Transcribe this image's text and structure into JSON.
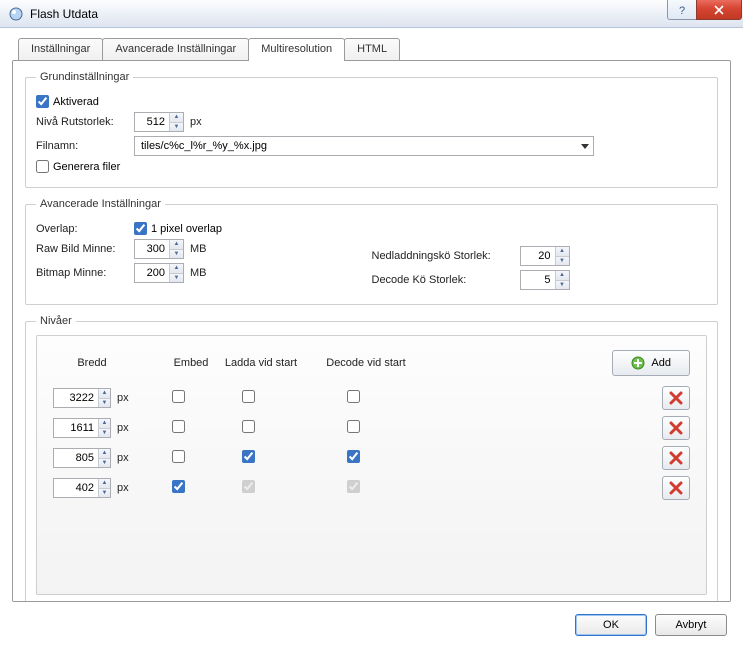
{
  "window": {
    "title": "Flash Utdata"
  },
  "tabs": {
    "settings": "Inställningar",
    "advanced": "Avancerade Inställningar",
    "multires": "Multiresolution",
    "html": "HTML",
    "active": "multires"
  },
  "basic": {
    "legend": "Grundinställningar",
    "enabled_label": "Aktiverad",
    "enabled": true,
    "gridsize_label": "Nivå Rutstorlek:",
    "gridsize": "512",
    "gridsize_unit": "px",
    "filename_label": "Filnamn:",
    "filename": "tiles/c%c_l%r_%y_%x.jpg",
    "generate_label": "Generera filer",
    "generate": false
  },
  "adv": {
    "legend": "Avancerade Inställningar",
    "overlap_label": "Overlap:",
    "overlap_check_label": "1 pixel overlap",
    "overlap": true,
    "raw_label": "Raw Bild Minne:",
    "raw_value": "300",
    "raw_unit": "MB",
    "bitmap_label": "Bitmap Minne:",
    "bitmap_value": "200",
    "bitmap_unit": "MB",
    "download_label": "Nedladdningskö Storlek:",
    "download_value": "20",
    "decode_label": "Decode Kö Storlek:",
    "decode_value": "5"
  },
  "levels": {
    "legend": "Nivåer",
    "head_width": "Bredd",
    "head_embed": "Embed",
    "head_load": "Ladda vid start",
    "head_decode": "Decode vid start",
    "add_label": "Add",
    "unit": "px",
    "rows": [
      {
        "width": "3222",
        "embed": false,
        "load": false,
        "decode": false,
        "load_disabled": false,
        "decode_disabled": false
      },
      {
        "width": "1611",
        "embed": false,
        "load": false,
        "decode": false,
        "load_disabled": false,
        "decode_disabled": false
      },
      {
        "width": "805",
        "embed": false,
        "load": true,
        "decode": true,
        "load_disabled": false,
        "decode_disabled": false
      },
      {
        "width": "402",
        "embed": true,
        "load": true,
        "decode": true,
        "load_disabled": true,
        "decode_disabled": true
      }
    ]
  },
  "footer": {
    "ok": "OK",
    "cancel": "Avbryt"
  }
}
